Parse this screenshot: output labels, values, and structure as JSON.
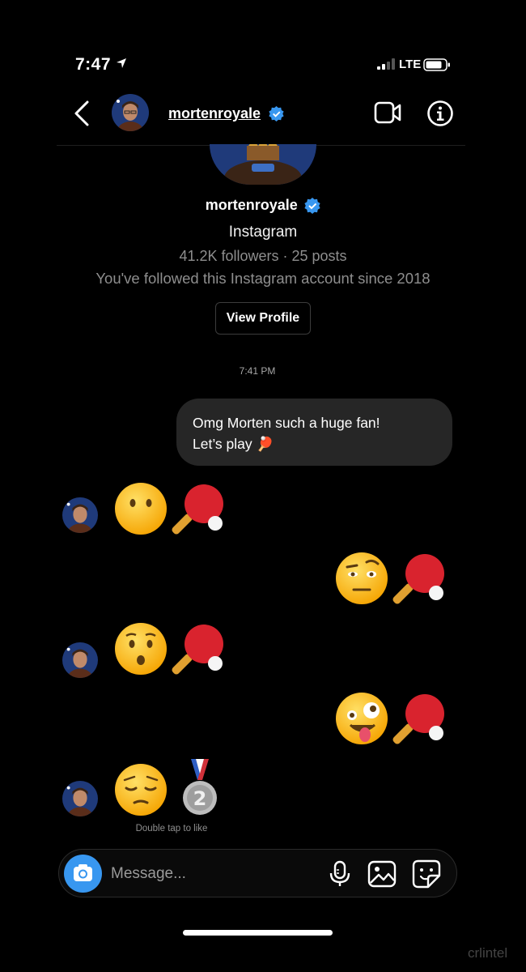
{
  "status_bar": {
    "time": "7:47",
    "network": "LTE"
  },
  "header": {
    "username": "mortenroyale",
    "verified": true
  },
  "profile": {
    "name": "mortenroyale",
    "subtitle": "Instagram",
    "stats": "41.2K followers · 25 posts",
    "since": "You've followed this Instagram account since 2018",
    "view_profile_label": "View Profile"
  },
  "thread": {
    "timestamp": "7:41 PM",
    "outgoing_message_line1": "Omg Morten such a huge fan!",
    "outgoing_message_line2": "Let’s play 🏓",
    "messages": [
      {
        "from": "them",
        "emojis": [
          "hushed-face",
          "ping-pong"
        ]
      },
      {
        "from": "me",
        "emojis": [
          "raised-eyebrow-face",
          "ping-pong"
        ]
      },
      {
        "from": "them",
        "emojis": [
          "astonished-face",
          "ping-pong"
        ]
      },
      {
        "from": "me",
        "emojis": [
          "zany-face",
          "ping-pong"
        ]
      },
      {
        "from": "them",
        "emojis": [
          "pensive-face",
          "second-place-medal"
        ]
      }
    ],
    "medal_number": "2",
    "like_hint": "Double tap to like"
  },
  "composer": {
    "placeholder": "Message..."
  },
  "watermark": "crlintel",
  "colors": {
    "background": "#000000",
    "bubble": "#262626",
    "accent": "#3897f0",
    "verified": "#3897f0",
    "muted": "#8e8e8e"
  }
}
